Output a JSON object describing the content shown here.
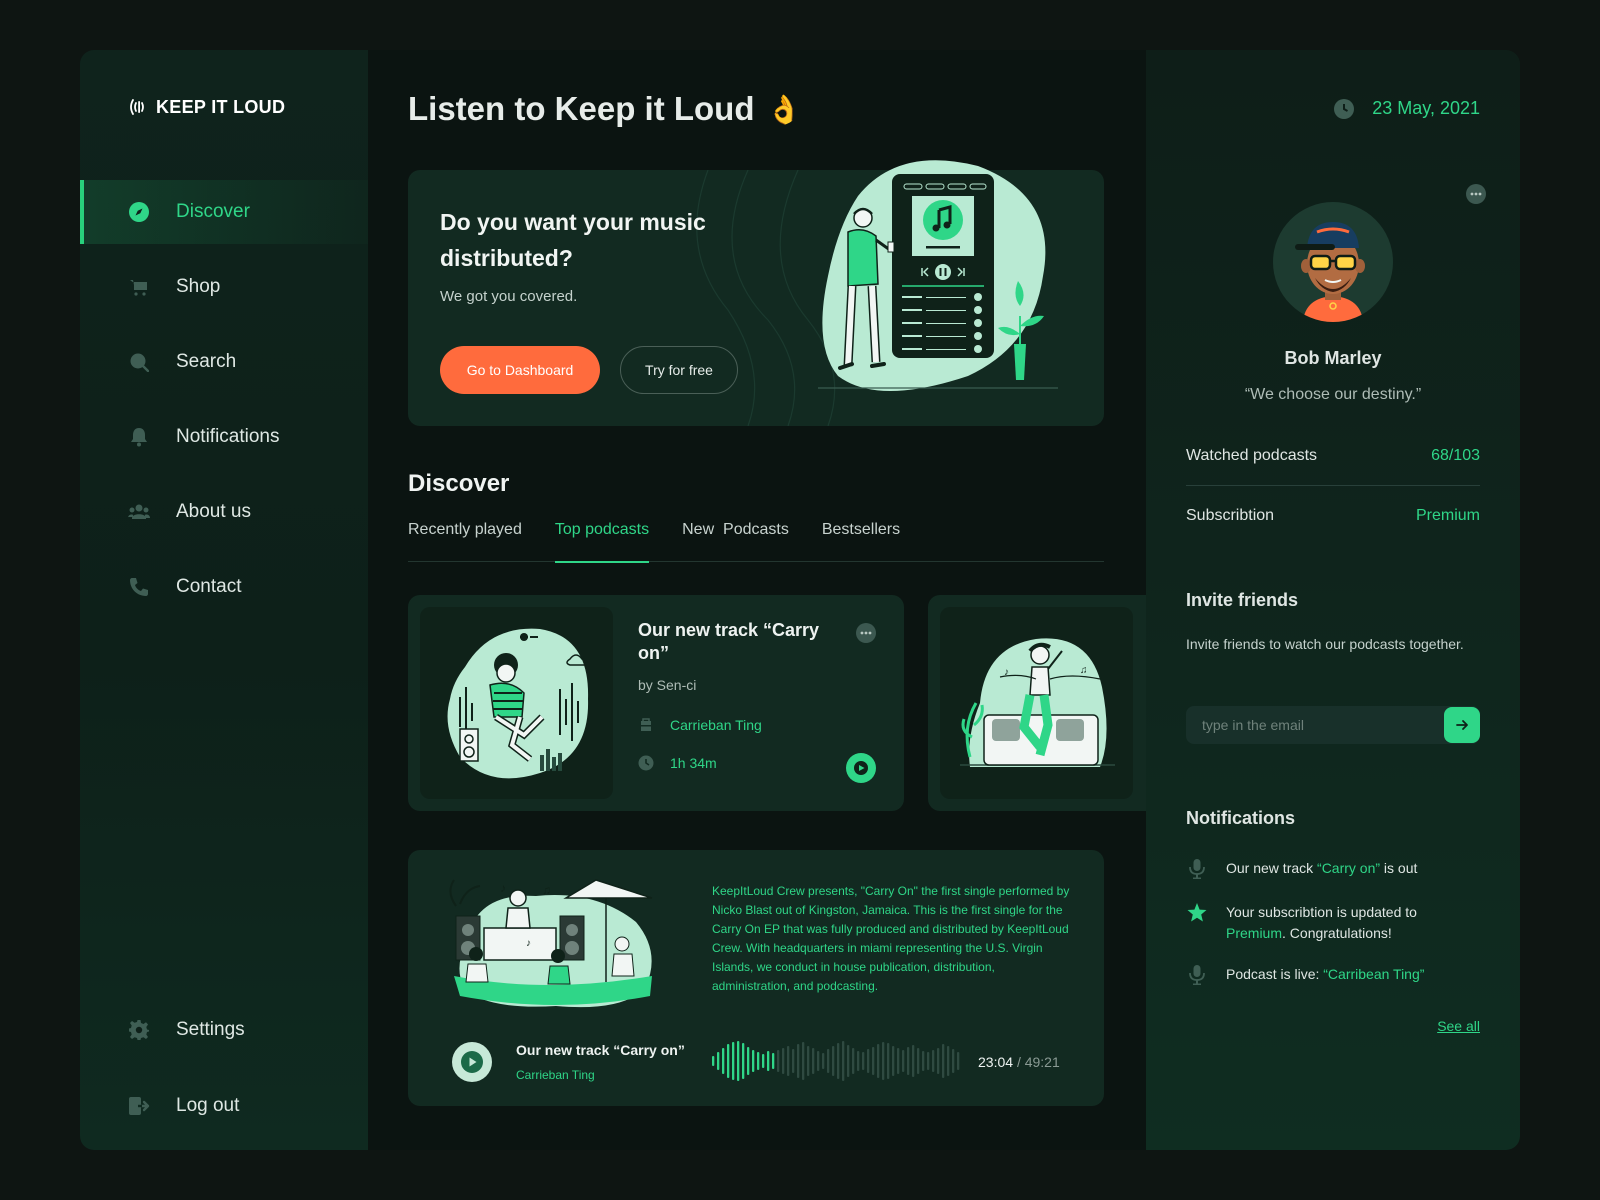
{
  "brand": {
    "name": "KEEP IT LOUD"
  },
  "sidebar": {
    "items": [
      {
        "label": "Discover",
        "icon": "compass-icon",
        "active": true
      },
      {
        "label": "Shop",
        "icon": "cart-icon"
      },
      {
        "label": "Search",
        "icon": "search-icon"
      },
      {
        "label": "Notifications",
        "icon": "bell-icon"
      },
      {
        "label": "About us",
        "icon": "users-icon"
      },
      {
        "label": "Contact",
        "icon": "phone-icon"
      }
    ],
    "bottom": [
      {
        "label": "Settings",
        "icon": "gear-icon"
      },
      {
        "label": "Log out",
        "icon": "logout-icon"
      }
    ]
  },
  "main": {
    "title": "Listen to Keep it Loud",
    "title_emoji": "👌",
    "hero": {
      "heading": "Do you want your music distributed?",
      "subtitle": "We got you covered.",
      "primary_button": "Go to Dashboard",
      "secondary_button": "Try for free"
    },
    "discover": {
      "title": "Discover",
      "tabs": [
        {
          "label": "Recently played"
        },
        {
          "label": "Top podcasts",
          "active": true
        },
        {
          "label": "New  Podcasts"
        },
        {
          "label": "Bestsellers"
        }
      ]
    },
    "card": {
      "title": "Our new track “Carry on”",
      "by": "by Sen-ci",
      "host": "Carrieban Ting",
      "duration": "1h 34m"
    },
    "player": {
      "description": "KeepItLoud Crew presents, \"Carry On\" the first single performed by Nicko Blast out of Kingston, Jamaica. This is the first single for the Carry On EP that was fully produced and distributed by KeepItLoud Crew. With headquarters in miami representing the U.S. Virgin Islands, we conduct in house publication, distribution, administration, and podcasting.",
      "track_title": "Our new track “Carry on”",
      "artist": "Carrieban Ting",
      "current_time": "23:04",
      "total_time": "/ 49:21",
      "progress": 0.47
    }
  },
  "right": {
    "date": "23 May, 2021",
    "user": {
      "name": "Bob Marley",
      "quote": "“We choose our destiny.”"
    },
    "stats": [
      {
        "label": "Watched podcasts",
        "value": "68/103"
      },
      {
        "label": "Subscribtion",
        "value": "Premium"
      }
    ],
    "invite": {
      "title": "Invite friends",
      "text": "Invite friends to watch our podcasts together.",
      "placeholder": "type in the email"
    },
    "notifications": {
      "title": "Notifications",
      "items": [
        {
          "pre": "Our new track ",
          "hl": "“Carry on”",
          "post": " is out",
          "icon": "microphone-icon"
        },
        {
          "pre": "Your subscribtion is updated to ",
          "hl": "Premium",
          "post": ". Congratulations!",
          "icon": "star-icon"
        },
        {
          "pre": "Podcast is live: ",
          "hl": "“Carribean Ting”",
          "post": "",
          "icon": "microphone-icon"
        }
      ],
      "see_all": "See all"
    }
  },
  "colors": {
    "accent": "#2fd688",
    "primary_button": "#ff6b3d",
    "background": "#0b1411"
  }
}
